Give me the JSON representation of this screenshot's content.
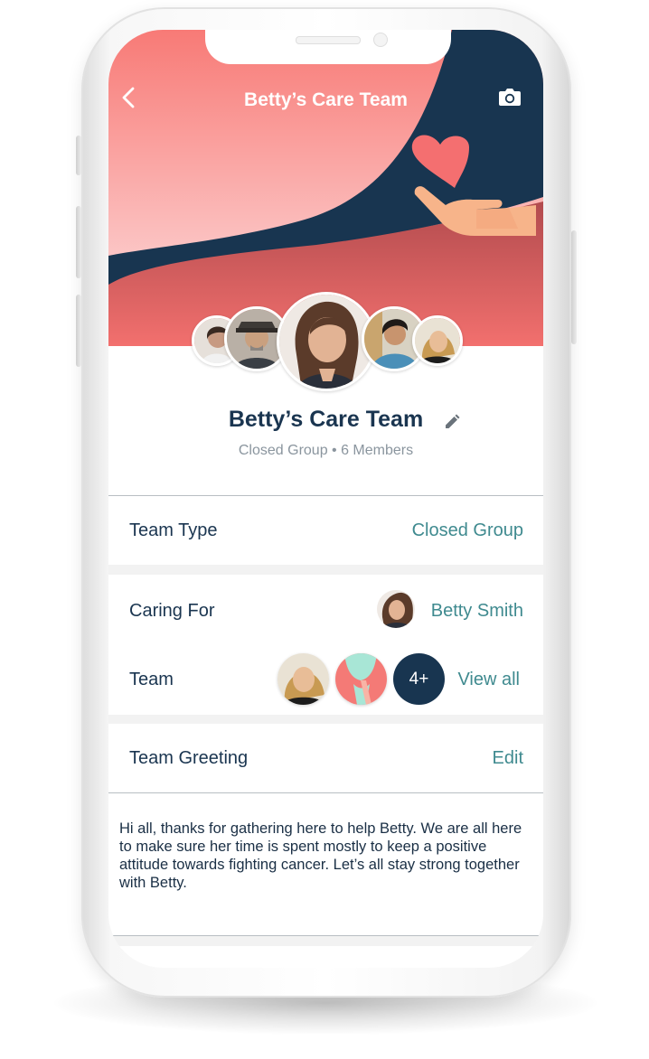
{
  "header": {
    "title": "Betty’s Care Team",
    "back_icon": "chevron-left-icon",
    "camera_icon": "camera-icon"
  },
  "profile": {
    "name": "Betty’s Care Team",
    "subtitle": "Closed Group • 6 Members",
    "edit_icon": "pencil-icon"
  },
  "details": {
    "team_type_label": "Team Type",
    "team_type_value": "Closed Group",
    "caring_for_label": "Caring For",
    "caring_for_value": "Betty Smith",
    "team_label": "Team",
    "more_members": "4+",
    "view_all": "View all",
    "greeting_label": "Team Greeting",
    "greeting_edit": "Edit",
    "greeting_text": "Hi all, thanks for gathering here to help Betty. We are all here to make sure her time is spent mostly to keep a positive attitude towards fighting cancer. Let’s all stay strong together with Betty."
  },
  "colors": {
    "navy": "#183550",
    "teal": "#3f8a8f",
    "coral": "#f47a76",
    "heart": "#f46f70",
    "hand": "#f7b48a"
  }
}
